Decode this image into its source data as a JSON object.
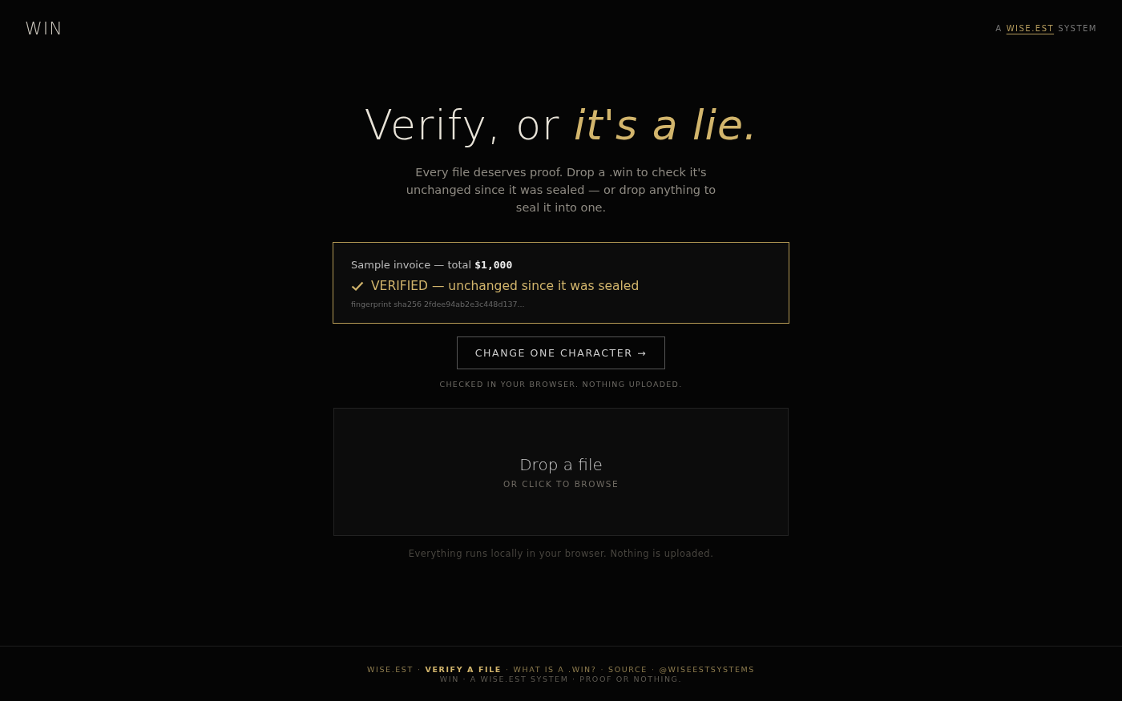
{
  "header": {
    "logo": "WIN",
    "tagline_prefix": "A",
    "tagline_link": "WISE.EST",
    "tagline_suffix": "SYSTEM"
  },
  "hero": {
    "title": "Verify, or *it's a lie.*",
    "subtitle": "Every file deserves proof. Drop a .win to check it's unchanged since it was sealed — or drop anything to seal it into one."
  },
  "sample": {
    "label": "Sample invoice — total **$1,000**",
    "status": {
      "kind": "verified",
      "text": "VERIFIED — unchanged since it was sealed"
    },
    "fingerprint": "fingerprint sha256 2fdee94ab2e3c448d137..."
  },
  "change_button": "CHANGE ONE CHARACTER →",
  "browser_note": "CHECKED IN YOUR BROWSER. NOTHING UPLOADED.",
  "dropzone": {
    "title": "Drop a file",
    "hint": "OR CLICK TO BROWSE"
  },
  "local_note": "Everything runs locally in your browser. Nothing is uploaded.",
  "footer": {
    "links": [
      {
        "label": "WISE.EST",
        "selected": false
      },
      {
        "label": "VERIFY A FILE",
        "selected": true
      },
      {
        "label": "WHAT IS A .WIN?",
        "selected": false
      },
      {
        "label": "SOURCE",
        "selected": false
      },
      {
        "label": "@WISEESTSYSTEMS",
        "selected": false
      }
    ],
    "separator": "·",
    "tagline": "WIN · A WISE.EST SYSTEM · PROOF OR NOTHING."
  }
}
